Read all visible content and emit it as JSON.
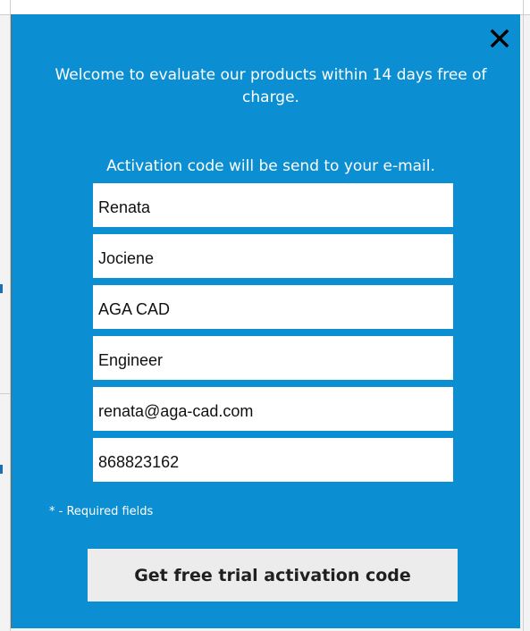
{
  "dialog": {
    "welcome_text": "Welcome to evaluate our products within 14 days free of charge.",
    "activation_note": "Activation code will be send to your e-mail.",
    "fields": [
      {
        "value": "Renata"
      },
      {
        "value": "Jociene"
      },
      {
        "value": "AGA CAD"
      },
      {
        "value": "Engineer"
      },
      {
        "value": "renata@aga-cad.com"
      },
      {
        "value": "868823162"
      }
    ],
    "required_note": "* - Required fields",
    "submit_label": "Get free trial activation code",
    "close_icon": "close-icon"
  },
  "colors": {
    "dialog_bg": "#0b8fd2",
    "text": "#ffffff",
    "button_bg": "#ececec"
  }
}
